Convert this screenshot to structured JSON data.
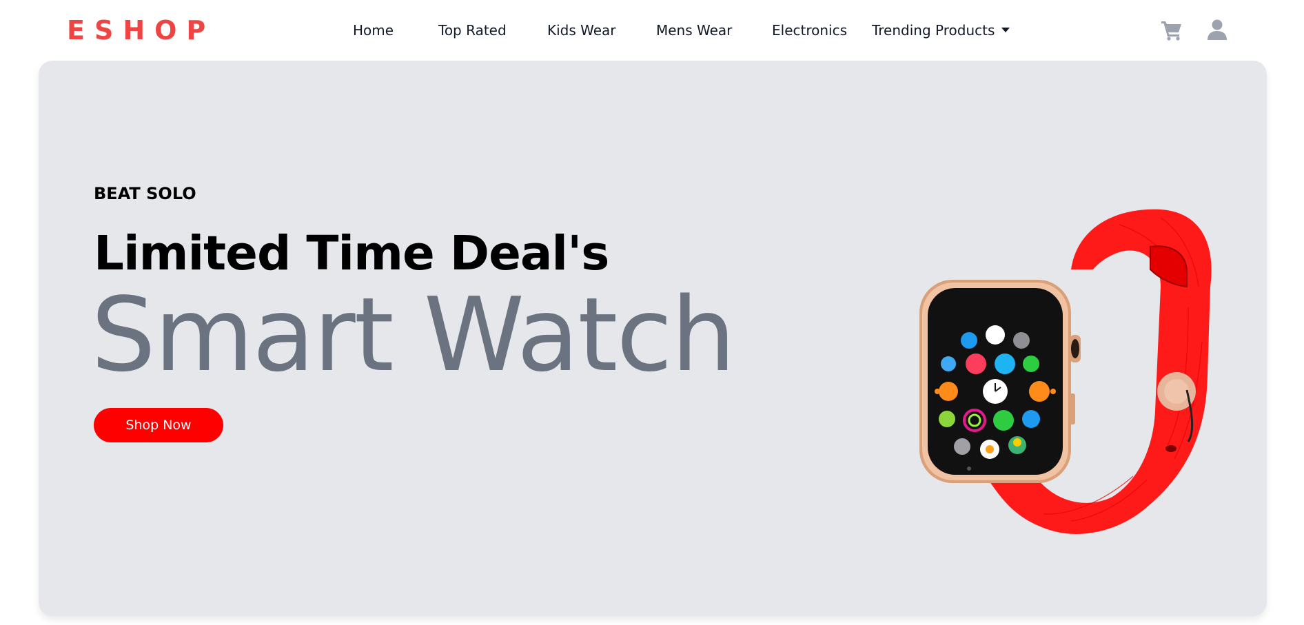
{
  "brand": {
    "logo": "ESHOP",
    "accent": "#ef4444"
  },
  "nav": {
    "items": [
      {
        "label": "Home"
      },
      {
        "label": "Top Rated"
      },
      {
        "label": "Kids Wear"
      },
      {
        "label": "Mens Wear"
      },
      {
        "label": "Electronics"
      },
      {
        "label": "Trending Products"
      }
    ],
    "dropdown_icon": "caret-down-icon"
  },
  "header_icons": [
    "cart-icon",
    "user-icon"
  ],
  "hero": {
    "subtitle": "BEAT SOLO",
    "title": "Limited Time Deal's",
    "product": "Smart Watch",
    "cta": "Shop Now",
    "background": "#e5e7eb",
    "cta_color": "#ff0000",
    "product_text_color": "#6b7280"
  }
}
